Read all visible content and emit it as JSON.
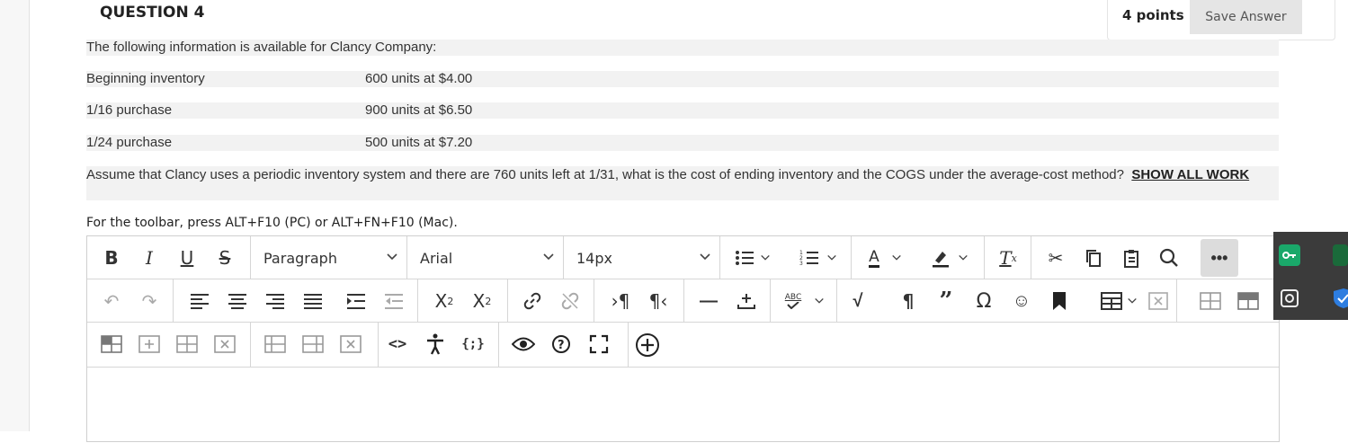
{
  "question": {
    "title": "QUESTION 4",
    "points": "4 points",
    "save_label": "Save Answer"
  },
  "problem": {
    "intro": "The following information is available for Clancy Company:",
    "rows": [
      {
        "label": "Beginning inventory",
        "value": "600 units at $4.00"
      },
      {
        "label": "1/16 purchase",
        "value": "900 units at $6.50"
      },
      {
        "label": "1/24 purchase",
        "value": "500 units at $7.20"
      }
    ],
    "question_text": "Assume that Clancy uses a periodic inventory system and there are 760 units left at 1/31, what is the cost of ending inventory and the COGS under the average-cost method?",
    "emphasis": "SHOW ALL WORK"
  },
  "editor": {
    "toolbar_hint": "For the toolbar, press ALT+F10 (PC) or ALT+FN+F10 (Mac).",
    "format_value": "Paragraph",
    "font_value": "Arial",
    "size_value": "14px",
    "abc_label": "ABC"
  },
  "colors": {
    "line_bg": "#f2f2f2",
    "save_bg": "#e5e5e5",
    "ext_bg": "#3b3b3b",
    "ext_green": "#1aa86a",
    "ext_blue": "#2d7de0"
  },
  "icons": {
    "row1": [
      "bold-icon",
      "italic-icon",
      "underline-icon",
      "strikethrough-icon",
      "bullet-list-icon",
      "numbered-list-icon",
      "text-color-icon",
      "highlight-icon",
      "clear-format-icon",
      "cut-icon",
      "copy-icon",
      "paste-icon",
      "search-icon",
      "more-icon"
    ],
    "row2": [
      "undo-icon",
      "redo-icon",
      "align-left-icon",
      "align-center-icon",
      "align-right-icon",
      "justify-icon",
      "indent-icon",
      "outdent-icon",
      "superscript-icon",
      "subscript-icon",
      "link-icon",
      "unlink-icon",
      "ltr-icon",
      "rtl-icon",
      "horizontal-rule-icon",
      "plus-minus-icon",
      "spellcheck-icon",
      "math-icon",
      "pilcrow-icon",
      "quote-icon",
      "omega-icon",
      "emoji-icon",
      "bookmark-icon",
      "table-icon",
      "table-delete-icon",
      "table-row-icon",
      "table-col-icon"
    ],
    "row3": [
      "table-cell-icon",
      "table-insert-icon",
      "table-plus-icon",
      "table-x-icon",
      "table-merge-icon",
      "table-split-icon",
      "table-remove-icon",
      "code-icon",
      "accessibility-icon",
      "code-braces-icon",
      "preview-icon",
      "help-icon",
      "fullscreen-icon",
      "add-content-icon"
    ]
  }
}
